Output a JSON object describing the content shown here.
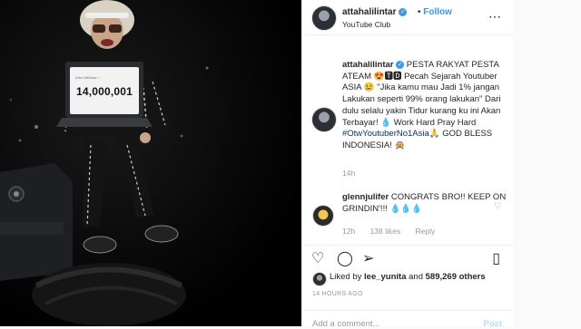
{
  "photo": {
    "laptop_header": "Atta Halilintar ✓",
    "subscriber_count": "14,000,001"
  },
  "post_header": {
    "username": "attahalilintar",
    "follow_label": "Follow",
    "location": "YouTube Club",
    "more_icon": "more-icon"
  },
  "caption": {
    "username": "attahalilintar",
    "text_1": "PESTA RAKYAT PESTA ATEAM 😍🆃🅳 Pecah Sejarah Youtuber ASIA 😢 \"Jika kamu mau Jadi 1% jangan Lakukan seperti 99% orang lakukan\" Dari dulu selalu yakin Tidur kurang ku ini Akan Terbayar! 💧 Work Hard Pray Hard",
    "hashtag": "#OtwYoutuberNo1Asia",
    "text_2": "🙏 GOD BLESS INDONESIA! 🙊",
    "time": "14h"
  },
  "comment": {
    "username": "glennjulifer",
    "text": "CONGRATS BRO!! KEEP ON GRINDIN'!!! 💧💧💧",
    "time": "12h",
    "likes": "138 likes",
    "reply": "Reply"
  },
  "likes": {
    "prefix": "Liked by ",
    "user": "lee_yunita",
    "middle": " and ",
    "count": "589,269 others"
  },
  "post_time": "14 HOURS AGO",
  "add_comment": {
    "placeholder": "Add a comment...",
    "post_label": "Post"
  },
  "colors": {
    "link_blue": "#3897f0",
    "hashtag_blue": "#003569",
    "muted": "#999999"
  }
}
